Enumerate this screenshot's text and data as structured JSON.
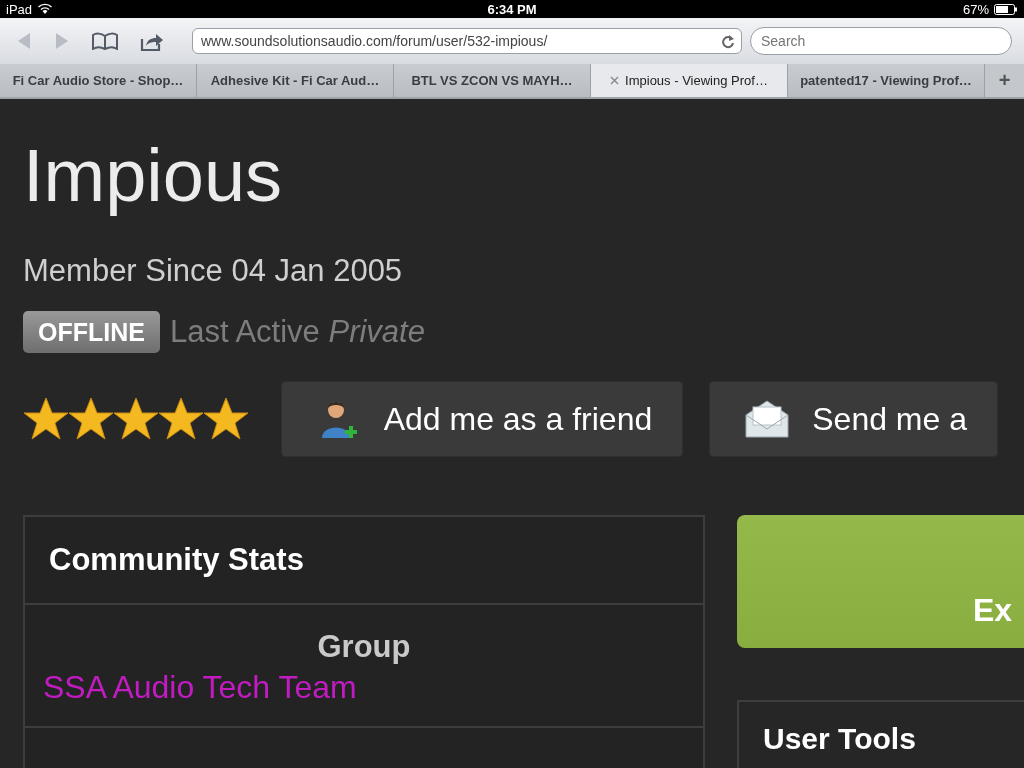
{
  "status_bar": {
    "device": "iPad",
    "time": "6:34 PM",
    "battery": "67%"
  },
  "toolbar": {
    "url": "www.soundsolutionsaudio.com/forum/user/532-impious/",
    "search_placeholder": "Search"
  },
  "tabs": [
    {
      "label": "Fi Car Audio Store - Shop…",
      "selected": false
    },
    {
      "label": "Adhesive Kit - Fi Car Aud…",
      "selected": false
    },
    {
      "label": "BTL VS ZCON VS MAYH…",
      "selected": false
    },
    {
      "label": "Impious - Viewing Prof…",
      "selected": true
    },
    {
      "label": "patented17 - Viewing Prof…",
      "selected": false
    }
  ],
  "new_tab": "+",
  "profile": {
    "name": "Impious",
    "member_since": "Member Since 04 Jan 2005",
    "status": "OFFLINE",
    "last_active": "Last Active *Private*",
    "stars": 5,
    "buttons": [
      {
        "kind": "friend",
        "label": "Add me as a friend"
      },
      {
        "kind": "message",
        "label": "Send me a"
      }
    ]
  },
  "community_stats": {
    "title": "Community Stats",
    "group": {
      "label": "Group",
      "value": "SSA Audio Tech Team",
      "color": "#c21bc2"
    }
  },
  "side_panel": {
    "banner_text": "Ex",
    "tools_title": "User Tools"
  }
}
